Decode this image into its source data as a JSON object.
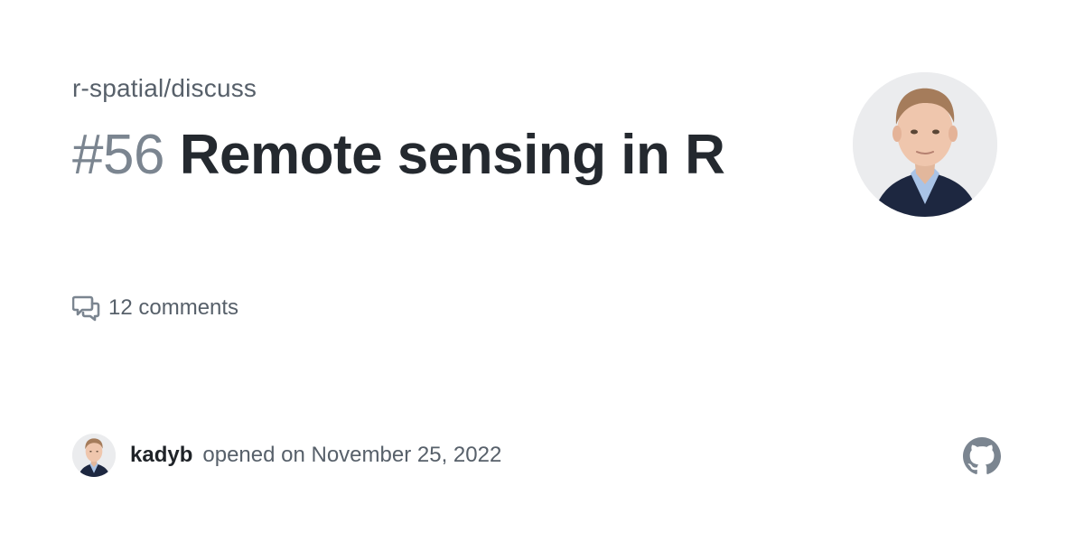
{
  "repository": "r-spatial/discuss",
  "discussion": {
    "number": "#56",
    "title": "Remote sensing in R",
    "comments": "12 comments"
  },
  "author": {
    "username": "kadyb",
    "opened_text": "opened on November 25, 2022"
  },
  "icons": {
    "comments": "comment-discussion-icon",
    "site": "github-mark-icon"
  },
  "colors": {
    "title": "#24292f",
    "number": "#7b8590",
    "muted": "#57606a",
    "icon": "#7b8590",
    "background": "#ffffff"
  }
}
